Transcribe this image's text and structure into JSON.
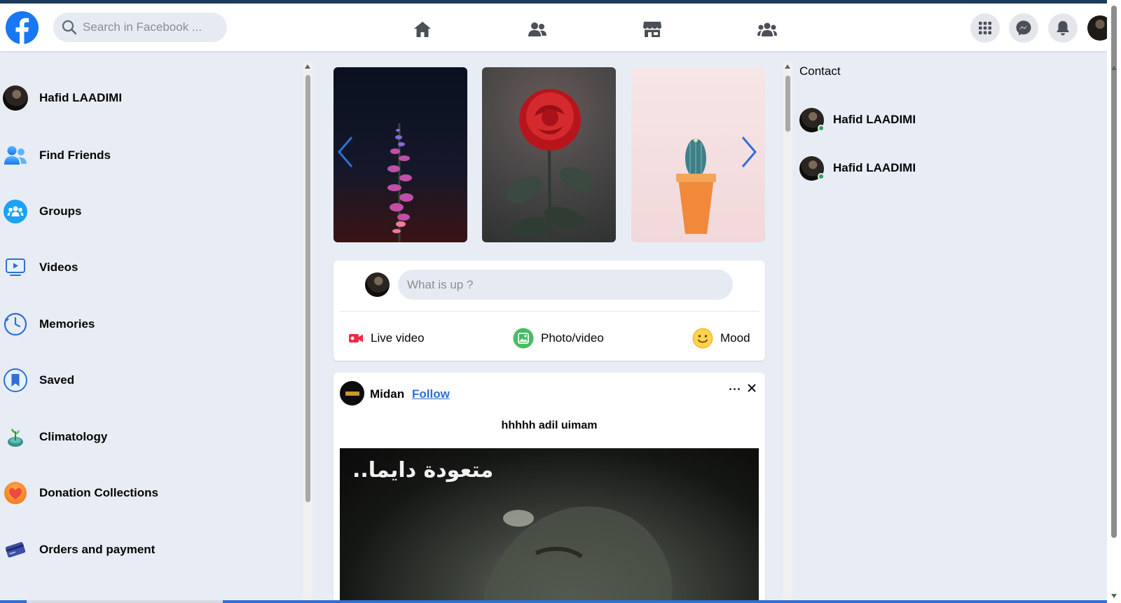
{
  "header": {
    "search_placeholder": "Search in Facebook ...",
    "nav": [
      "home-icon",
      "friends-icon",
      "marketplace-icon",
      "groups-icon"
    ],
    "right_icons": [
      "menu-grid-icon",
      "messenger-icon",
      "bell-icon"
    ],
    "brand_color": "#1877f2"
  },
  "sidebar": {
    "items": [
      {
        "label": "Hafid LAADIMI",
        "icon": "profile-avatar"
      },
      {
        "label": "Find Friends",
        "icon": "friends-icon"
      },
      {
        "label": "Groups",
        "icon": "groups-icon"
      },
      {
        "label": "Videos",
        "icon": "video-icon"
      },
      {
        "label": "Memories",
        "icon": "clock-icon"
      },
      {
        "label": "Saved",
        "icon": "bookmark-icon"
      },
      {
        "label": "Climatology",
        "icon": "plant-icon"
      },
      {
        "label": "Donation Collections",
        "icon": "heart-icon"
      },
      {
        "label": "Orders and payment",
        "icon": "card-icon"
      }
    ]
  },
  "composer": {
    "placeholder": "What is up ?",
    "actions": [
      {
        "label": "Live video",
        "icon": "live-video-icon"
      },
      {
        "label": "Photo/video",
        "icon": "photo-icon"
      },
      {
        "label": "Mood",
        "icon": "smiley-icon"
      }
    ]
  },
  "post": {
    "author": "Midan",
    "follow_label": "Follow",
    "text": "hhhhh adil uimam",
    "media_caption": "متعودة دايما.."
  },
  "contacts": {
    "title": "Contact",
    "items": [
      {
        "name": "Hafid LAADIMI"
      },
      {
        "name": "Hafid LAADIMI"
      }
    ]
  }
}
